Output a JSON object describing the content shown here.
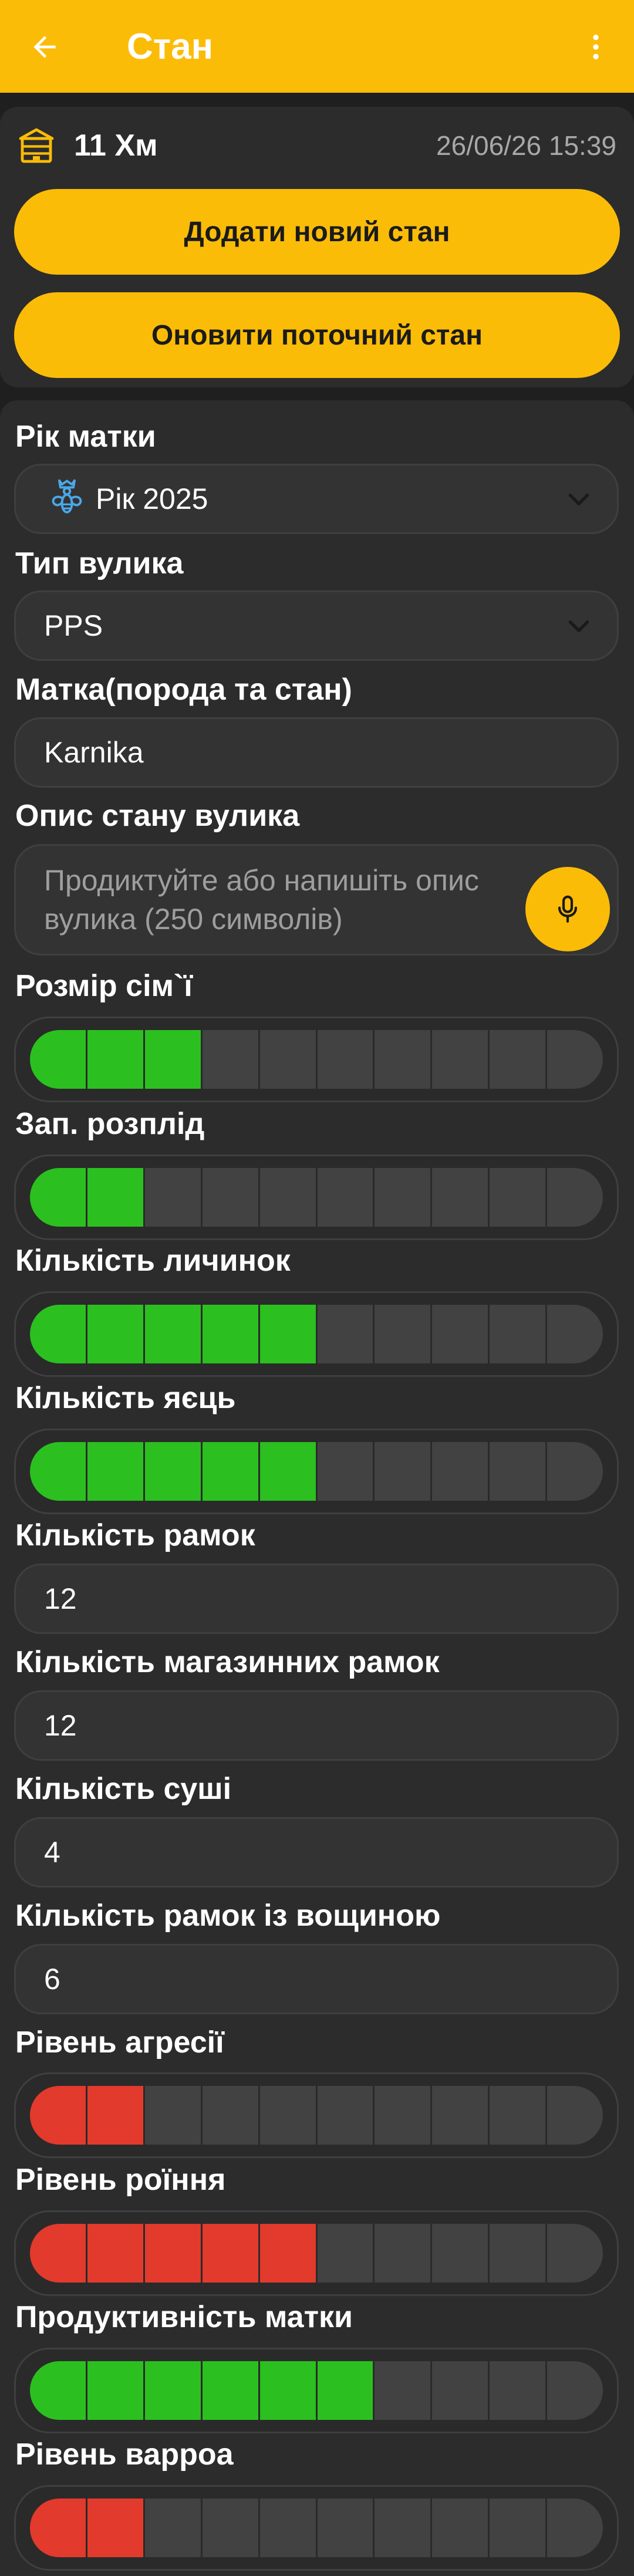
{
  "appbar": {
    "title": "Стан",
    "back_icon": "arrow-left-icon",
    "more_icon": "more-vertical-icon"
  },
  "hive": {
    "name": "11 Хм",
    "datetime": "26/06/26 15:39",
    "icon": "beehive-icon"
  },
  "actions": {
    "add_label": "Додати новий стан",
    "update_label": "Оновити поточний стан"
  },
  "form": {
    "queen_year": {
      "label": "Рік матки",
      "value": "Рік 2025",
      "icon": "queen-bee-icon"
    },
    "hive_type": {
      "label": "Тип вулика",
      "value": "PPS"
    },
    "queen_breed": {
      "label": "Матка(порода та стан)",
      "value": "Karnika"
    },
    "description": {
      "label": "Опис стану вулика",
      "placeholder": "Продиктуйте або напишіть опис вулика (250 символів)",
      "icon": "microphone-icon"
    },
    "frames": {
      "label": "Кількість рамок",
      "value": "12"
    },
    "super_frames": {
      "label": "Кількість магазинних рамок",
      "value": "12"
    },
    "drawn_comb": {
      "label": "Кількість суші",
      "value": "4"
    },
    "foundation_frames": {
      "label": "Кількість рамок із вощиною",
      "value": "6"
    }
  },
  "levels": {
    "total_segments": 10,
    "colors": {
      "good": "#2bc01f",
      "bad": "#e23a2c",
      "empty": "#424242"
    },
    "family_size": {
      "label": "Розмір сім`ї",
      "value": 3,
      "color": "good"
    },
    "sealed_brood": {
      "label": "Зап. розплід",
      "value": 2,
      "color": "good"
    },
    "larvae": {
      "label": "Кількість личинок",
      "value": 5,
      "color": "good"
    },
    "eggs": {
      "label": "Кількість яєць",
      "value": 5,
      "color": "good"
    },
    "aggression": {
      "label": "Рівень агресії",
      "value": 2,
      "color": "bad"
    },
    "swarming": {
      "label": "Рівень роїння",
      "value": 5,
      "color": "bad"
    },
    "queen_productivity": {
      "label": "Продуктивність матки",
      "value": 6,
      "color": "good"
    },
    "varroa": {
      "label": "Рівень варроа",
      "value": 2,
      "color": "bad"
    }
  },
  "colors": {
    "accent": "#fbbc08",
    "background": "#1f1f1f",
    "card": "#2c2c2c",
    "date_text": "#a8a8a8"
  }
}
